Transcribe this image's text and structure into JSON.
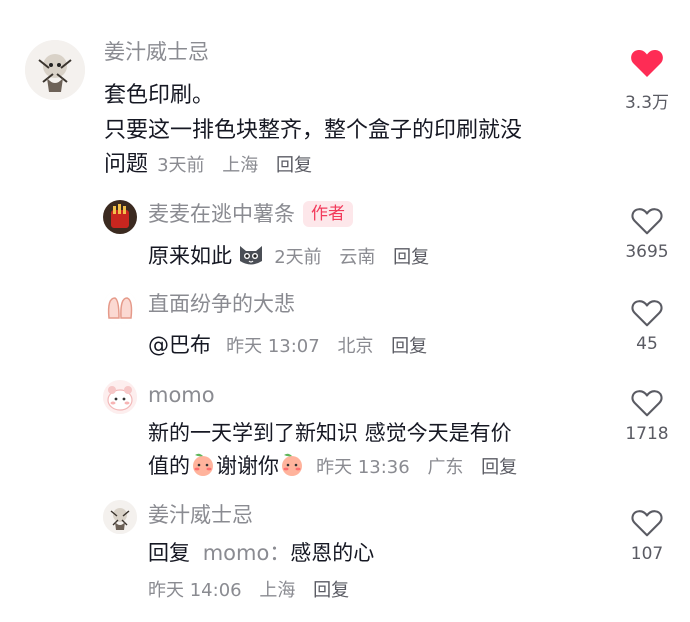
{
  "colors": {
    "liked": "#fe2c55",
    "muted": "#8a8b91",
    "author_tag_bg": "#fde7ea",
    "author_tag_text": "#f23a5b"
  },
  "comments": [
    {
      "username": "姜汁威士忌",
      "lines": [
        "套色印刷。",
        "只要这一排色块整齐，整个盒子的印刷就没",
        "问题"
      ],
      "time": "3天前",
      "location": "上海",
      "reply": "回复",
      "likes": "3.3万",
      "liked": true,
      "icon": "heart-filled-icon"
    },
    {
      "username": "麦麦在逃中薯条",
      "author_tag": "作者",
      "text": "原来如此",
      "emoji": "cat-face-emoji",
      "time": "2天前",
      "location": "云南",
      "reply": "回复",
      "likes": "3695",
      "liked": false,
      "icon": "heart-outline-icon"
    },
    {
      "username": "直面纷争的大悲",
      "text": "@巴布",
      "time": "昨天 13:07",
      "location": "北京",
      "reply": "回复",
      "likes": "45",
      "liked": false,
      "icon": "heart-outline-icon"
    },
    {
      "username": "momo",
      "line1": "新的一天学到了新知识 感觉今天是有价",
      "line2_a": "值的",
      "line2_b": "谢谢你",
      "emoji": "peach-blush-emoji",
      "time": "昨天 13:36",
      "location": "广东",
      "reply": "回复",
      "likes": "1718",
      "liked": false,
      "icon": "heart-outline-icon"
    },
    {
      "username": "姜汁威士忌",
      "reply_prefix": "回复",
      "reply_to": "momo：",
      "text": "感恩的心",
      "time": "昨天 14:06",
      "location": "上海",
      "reply": "回复",
      "likes": "107",
      "liked": false,
      "icon": "heart-outline-icon"
    }
  ]
}
